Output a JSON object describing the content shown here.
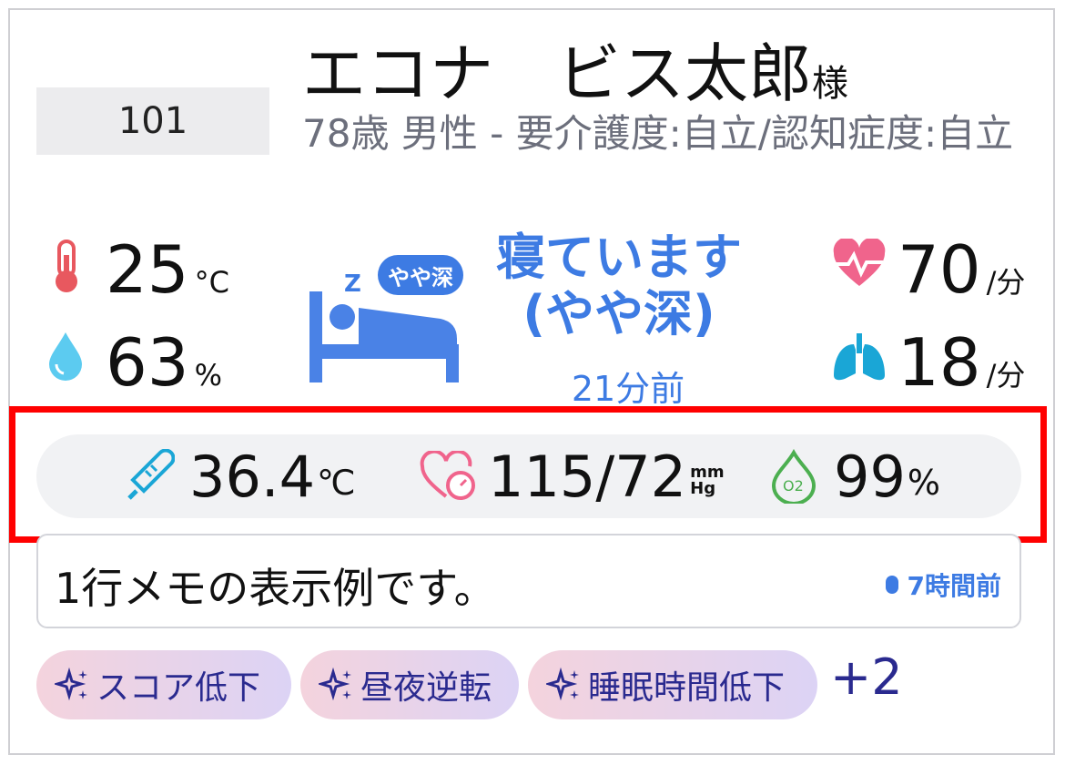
{
  "resident": {
    "room": "101",
    "name": "エコナ　ビス太郎",
    "honorific": "様",
    "info": "78歳 男性 - 要介護度:自立/認知症度:自立"
  },
  "environment": {
    "temperature": {
      "value": "25",
      "unit": "°C",
      "icon": "thermometer-icon"
    },
    "humidity": {
      "value": "63",
      "unit": "%",
      "icon": "water-drop-icon"
    }
  },
  "sleep": {
    "badge": "やや深",
    "status_line1": "寝ています",
    "status_line2": "(やや深)",
    "ago": "21分前",
    "icon": "bed-icon"
  },
  "heart": {
    "value": "70",
    "unit": "/分",
    "icon": "heart-pulse-icon"
  },
  "respiration": {
    "value": "18",
    "unit": "/分",
    "icon": "lungs-icon"
  },
  "vitals": {
    "body_temp": {
      "value": "36.4",
      "unit": "℃"
    },
    "blood_pressure": {
      "value": "115/72",
      "unit_top": "mm",
      "unit_bottom": "Hg"
    },
    "spo2": {
      "value": "99",
      "unit": "%",
      "icon_label": "O2"
    }
  },
  "memo": {
    "text": "1行メモの表示例です。",
    "time": "7時間前"
  },
  "tags": [
    "スコア低下",
    "昼夜逆転",
    "睡眠時間低下"
  ],
  "more_tags": "+2",
  "colors": {
    "accent": "#3d7be3",
    "highlight": "#ff0000",
    "tag_text": "#2a2a8f",
    "heart": "#f0648c",
    "lungs": "#1aa6d6",
    "thermo": "#e8585f",
    "spo2": "#4caf50"
  }
}
